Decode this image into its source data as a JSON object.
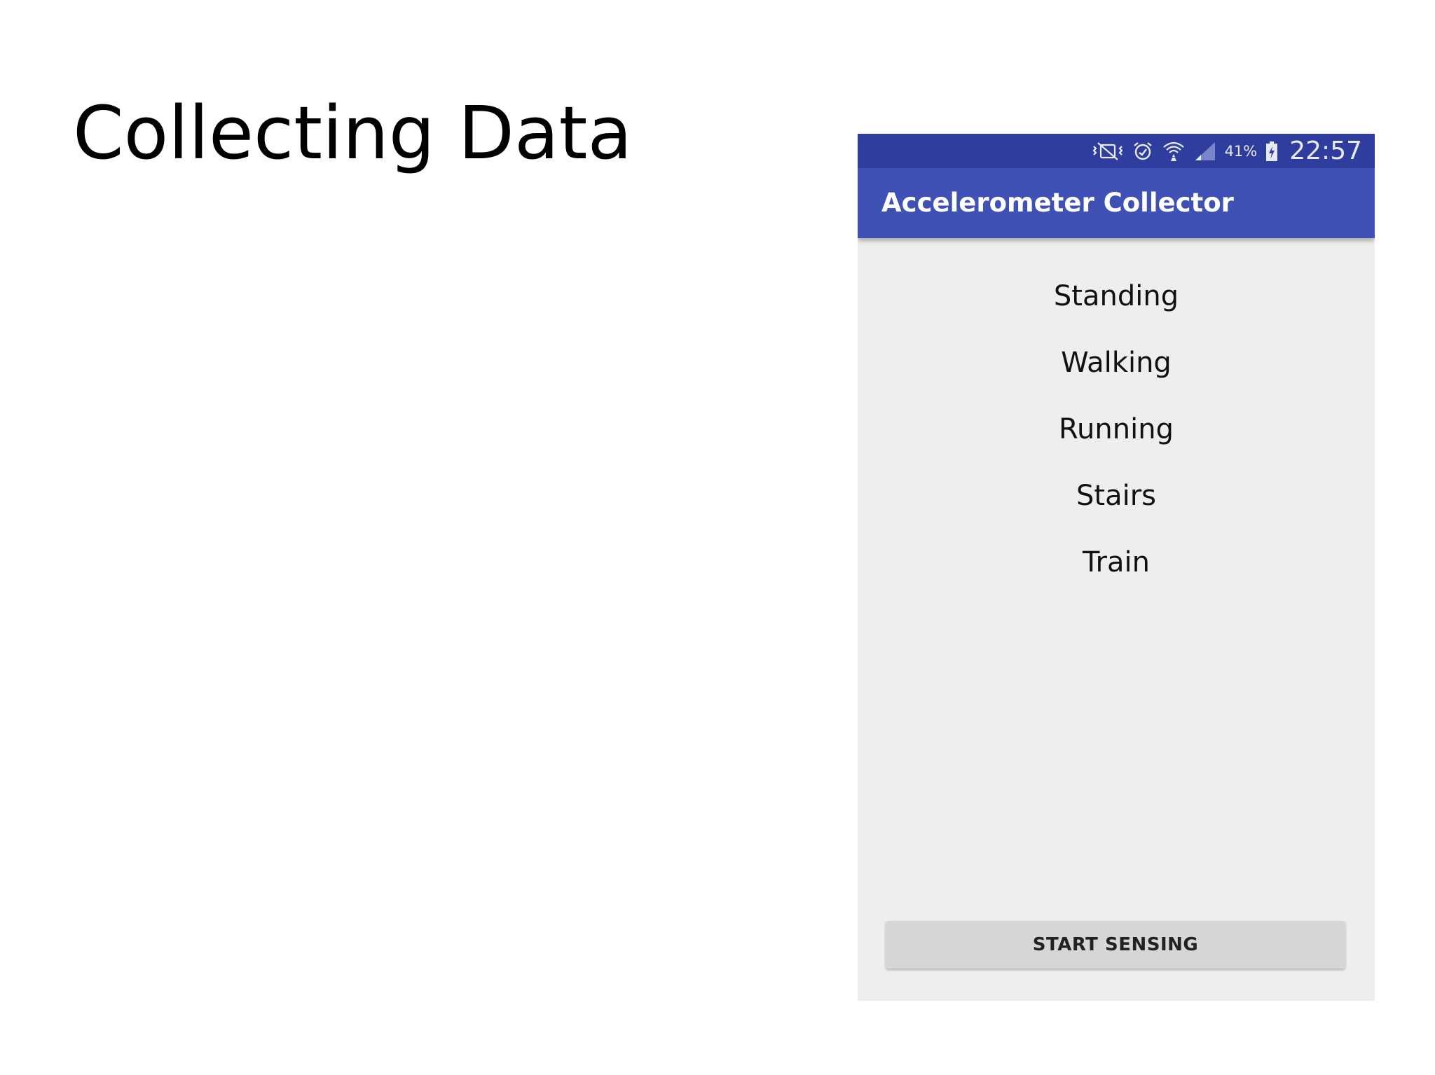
{
  "slide": {
    "title": "Collecting Data"
  },
  "status_bar": {
    "icons": [
      "vibrate-mute-icon",
      "alarm-icon",
      "wifi-icon",
      "signal-icon",
      "battery-charging-icon"
    ],
    "battery_percent": "41%",
    "time": "22:57"
  },
  "app_bar": {
    "title": "Accelerometer Collector"
  },
  "activities": [
    {
      "label": "Standing"
    },
    {
      "label": "Walking"
    },
    {
      "label": "Running"
    },
    {
      "label": "Stairs"
    },
    {
      "label": "Train"
    }
  ],
  "start_button": {
    "label": "START SENSING"
  },
  "colors": {
    "status_bar": "#2f3e9e",
    "app_bar": "#3f51b5",
    "screen_background": "#eeeeee",
    "button_background": "#d6d6d6"
  }
}
